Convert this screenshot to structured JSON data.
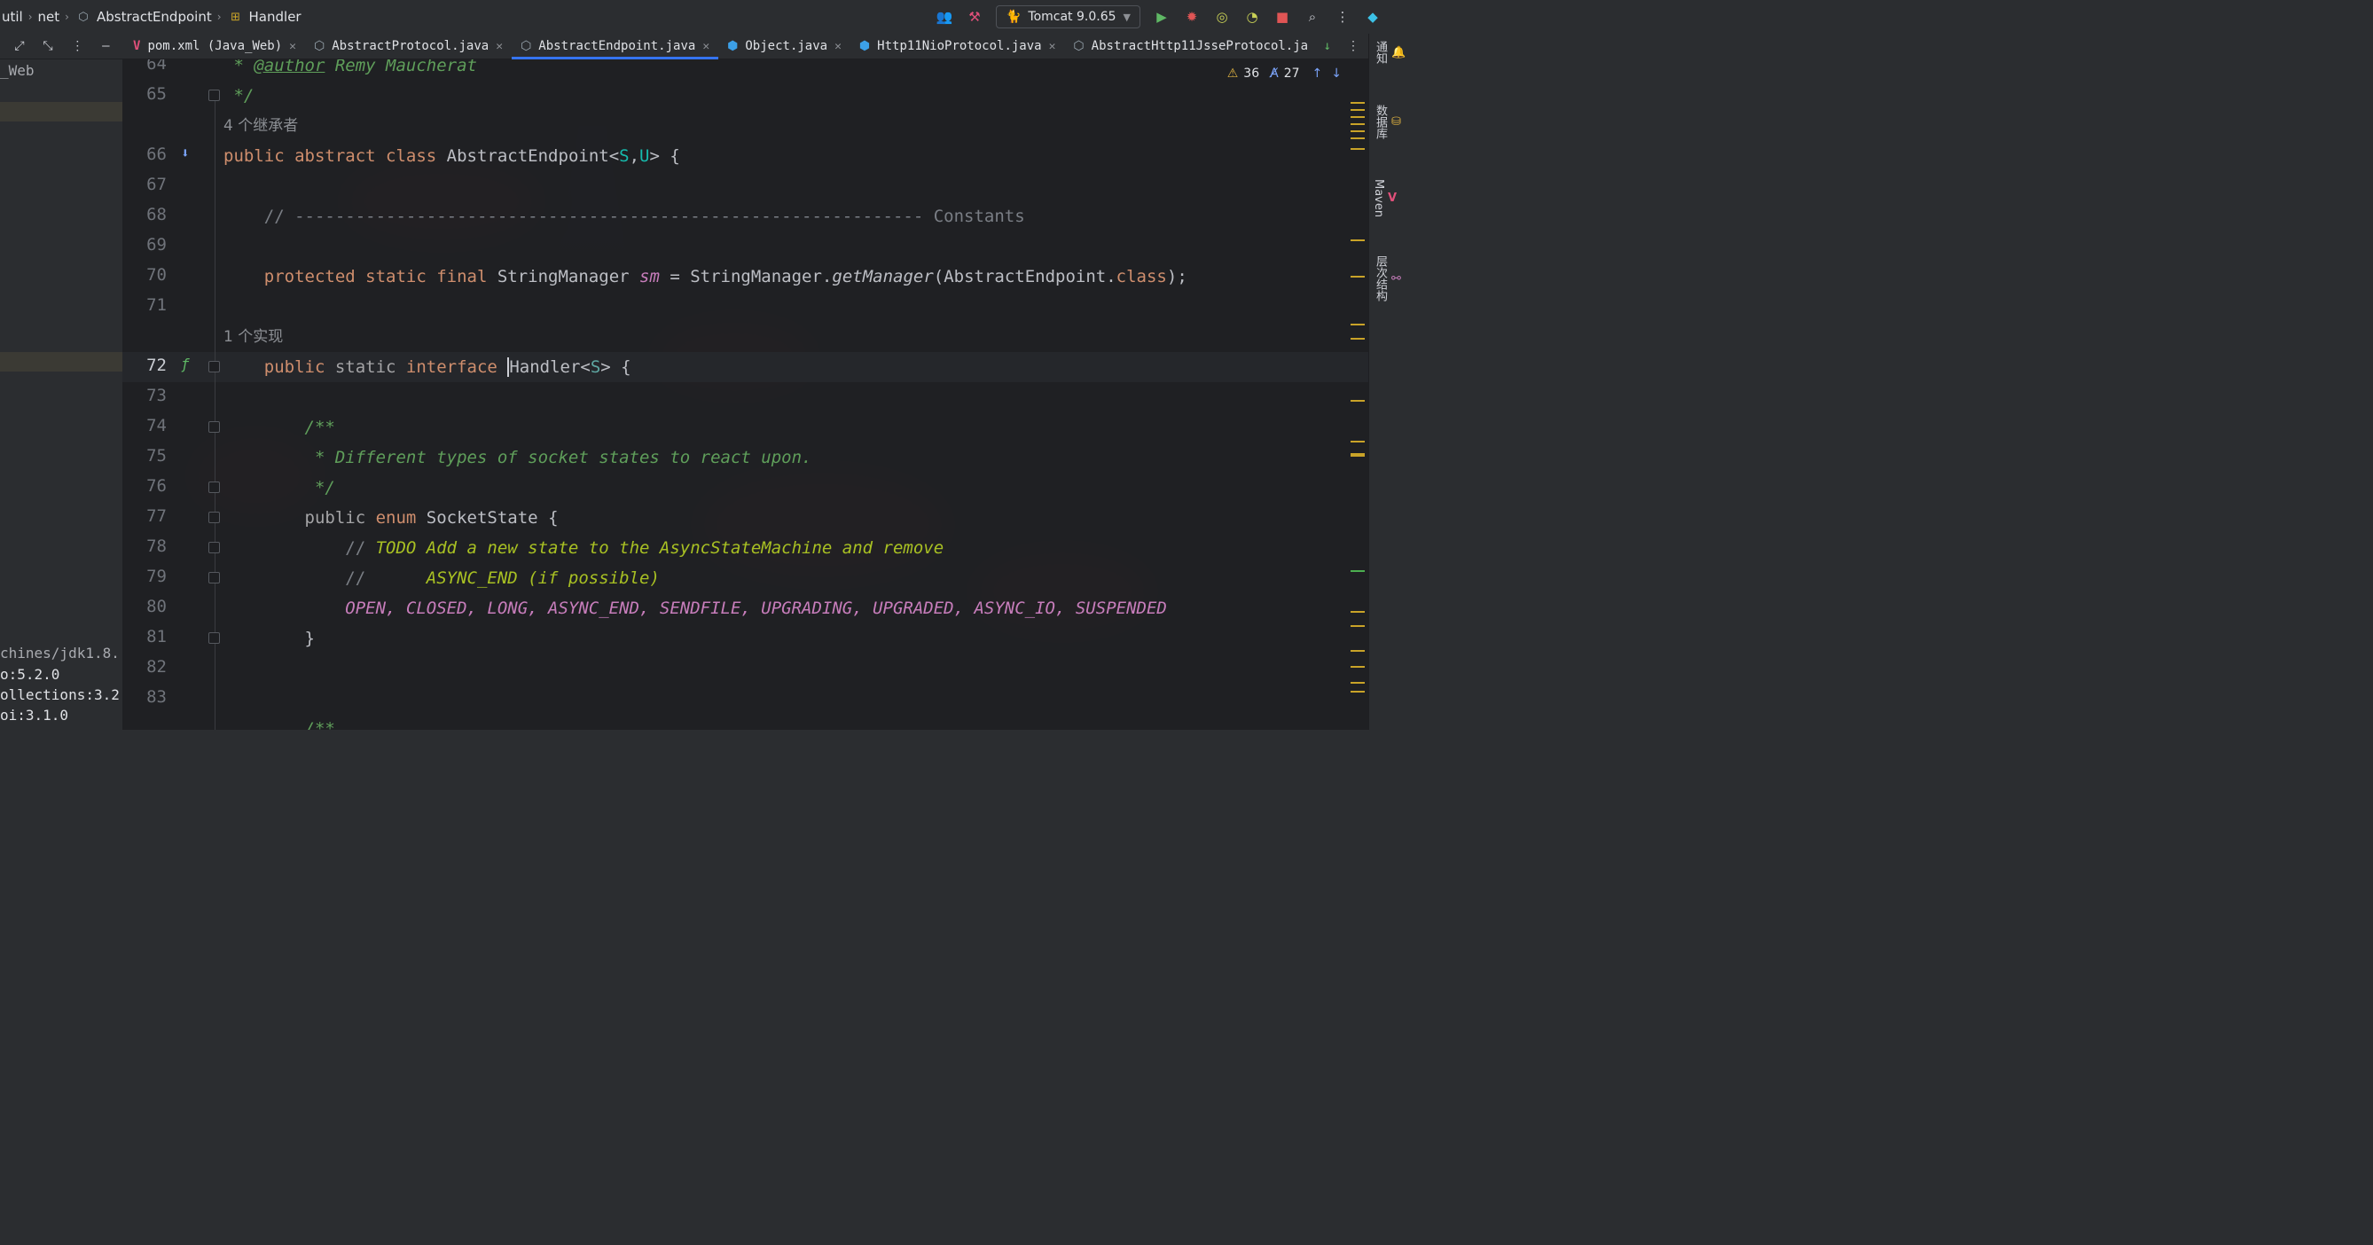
{
  "breadcrumb": {
    "items": [
      "util",
      "net",
      "AbstractEndpoint",
      "Handler"
    ]
  },
  "toolbar": {
    "run_config": "Tomcat 9.0.65"
  },
  "tabs": [
    {
      "label": "pom.xml (Java_Web)",
      "icon": "maven-icon",
      "active": false
    },
    {
      "label": "AbstractProtocol.java",
      "icon": "abstract-class-icon",
      "active": false
    },
    {
      "label": "AbstractEndpoint.java",
      "icon": "abstract-class-icon",
      "active": true
    },
    {
      "label": "Object.java",
      "icon": "class-icon",
      "active": false
    },
    {
      "label": "Http11NioProtocol.java",
      "icon": "class-icon",
      "active": false
    },
    {
      "label": "AbstractHttp11JsseProtocol.ja",
      "icon": "abstract-class-icon",
      "active": false
    }
  ],
  "left_panel": {
    "project_suffix": "_Web",
    "lines": [
      "chines/jdk1.8.(",
      "o:5.2.0",
      "ollections:3.2",
      "oi:3.1.0"
    ]
  },
  "inspection": {
    "warnings": "36",
    "typos": "27"
  },
  "right_toolbar": [
    "通知",
    "数据库",
    "Maven",
    "层次结构"
  ],
  "editor": {
    "current_line": "72",
    "hint_inheritors": "4 个继承者",
    "hint_impl": "1 个实现",
    "line_numbers": [
      "64",
      "65",
      "66",
      "67",
      "68",
      "69",
      "70",
      "71",
      "72",
      "73",
      "74",
      "75",
      "76",
      "77",
      "78",
      "79",
      "80",
      "81",
      "82",
      "83"
    ],
    "code": {
      "l64_a": " * ",
      "l64_b": "@author",
      "l64_c": " Remy Maucherat",
      "l65": " */",
      "l66_a": "public abstract class ",
      "l66_b": "AbstractEndpoint<",
      "l66_c": "S",
      "l66_d": ",",
      "l66_e": "U",
      "l66_f": "> {",
      "l68_a": "    // ",
      "l68_b": "-------------------------------------------------------------- Constants",
      "l70_a": "    protected static final ",
      "l70_b": "StringManager ",
      "l70_c": "sm",
      "l70_d": " = StringManager.",
      "l70_e": "getManager",
      "l70_f": "(AbstractEndpoint.",
      "l70_g": "class",
      "l70_h": ");",
      "l72_a": "    public ",
      "l72_b": "static ",
      "l72_c": "interface ",
      "l72_d": "Handler<",
      "l72_e": "S",
      "l72_f": "> {",
      "l74": "        /**",
      "l75": "         * Different types of socket states to react upon.",
      "l76": "         */",
      "l77_a": "        public ",
      "l77_b": "enum ",
      "l77_c": "SocketState {",
      "l78_a": "            // ",
      "l78_b": "TODO Add a new state to the AsyncStateMachine and remove",
      "l79_a": "            //      ",
      "l79_b": "ASYNC_END (if possible)",
      "l80": "            OPEN, CLOSED, LONG, ASYNC_END, SENDFILE, UPGRADING, UPGRADED, ASYNC_IO, SUSPENDED",
      "l81": "        }",
      "l84": "        /**"
    }
  },
  "colors": {
    "accent": "#3574f0",
    "keyword": "#cf8e6d",
    "type_param": "#16baac",
    "doc_comment": "#5f9e5a",
    "todo": "#a8c023",
    "enum_const": "#c77dbb"
  }
}
